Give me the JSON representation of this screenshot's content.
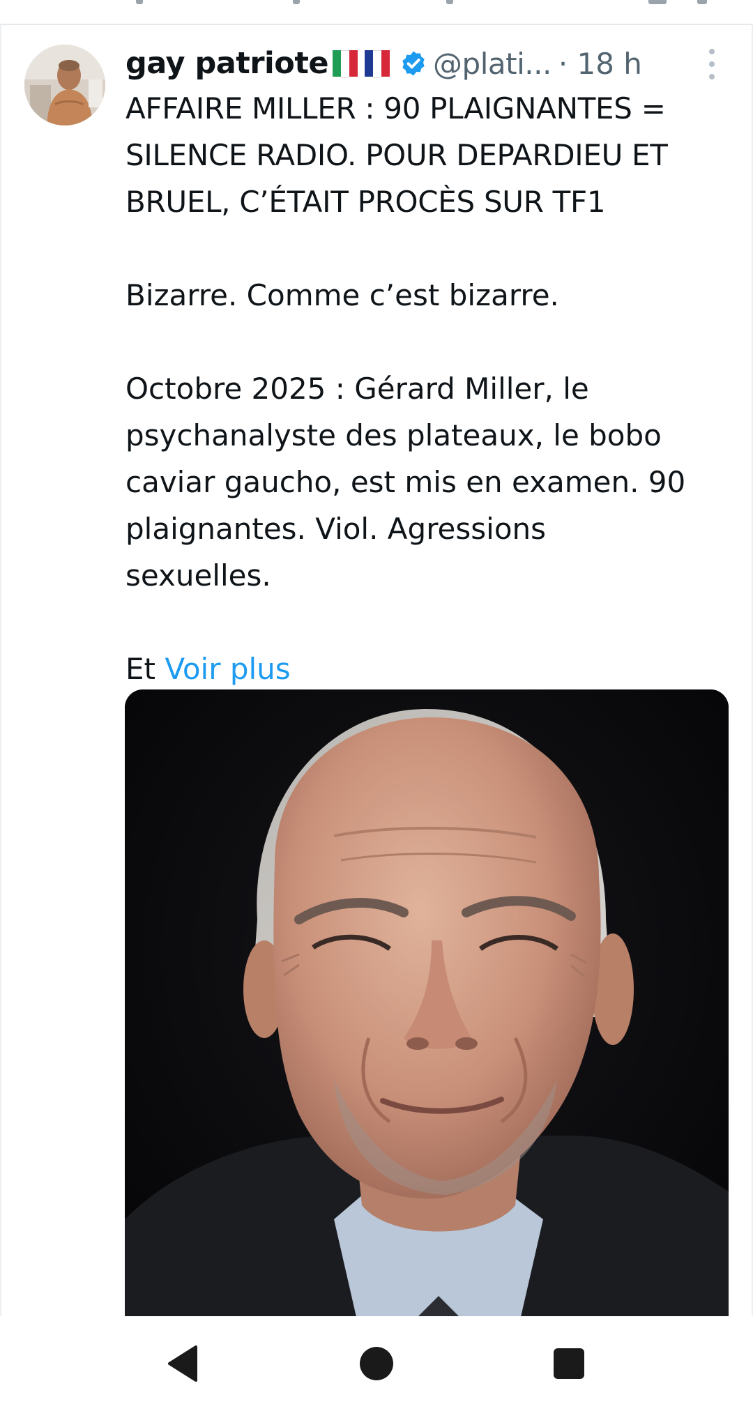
{
  "tweet": {
    "display_name": "gay patriote",
    "handle": "@plati...",
    "separator_time": "· 18 h",
    "headline_lines": [
      "AFFAIRE MILLER : 90 PLAIGNANTES =",
      "SILENCE RADIO. POUR DEPARDIEU ET",
      "BRUEL, C’ÉTAIT PROCÈS SUR TF1"
    ],
    "paragraph_2": "Bizarre. Comme c’est bizarre.",
    "paragraph_3_lines": [
      "Octobre 2025 : Gérard Miller, le",
      "psychanalyste des plateaux, le bobo",
      "caviar gaucho, est mis en examen. 90",
      "plaignantes. Viol. Agressions",
      "sexuelles."
    ],
    "truncated_prefix": "Et",
    "see_more": "Voir plus",
    "flags": [
      "italy-flag",
      "france-flag"
    ],
    "verified_icon": "verified-badge-icon",
    "more_icon": "more-vertical-icon"
  },
  "colors": {
    "text_primary": "#0f1419",
    "text_secondary": "#536471",
    "link": "#1d9bf0",
    "verified": "#1d9bf0",
    "nav_icons": "#1a1a1a"
  },
  "nav": {
    "back": "back-triangle-icon",
    "home": "home-circle-icon",
    "recents": "recents-square-icon"
  }
}
